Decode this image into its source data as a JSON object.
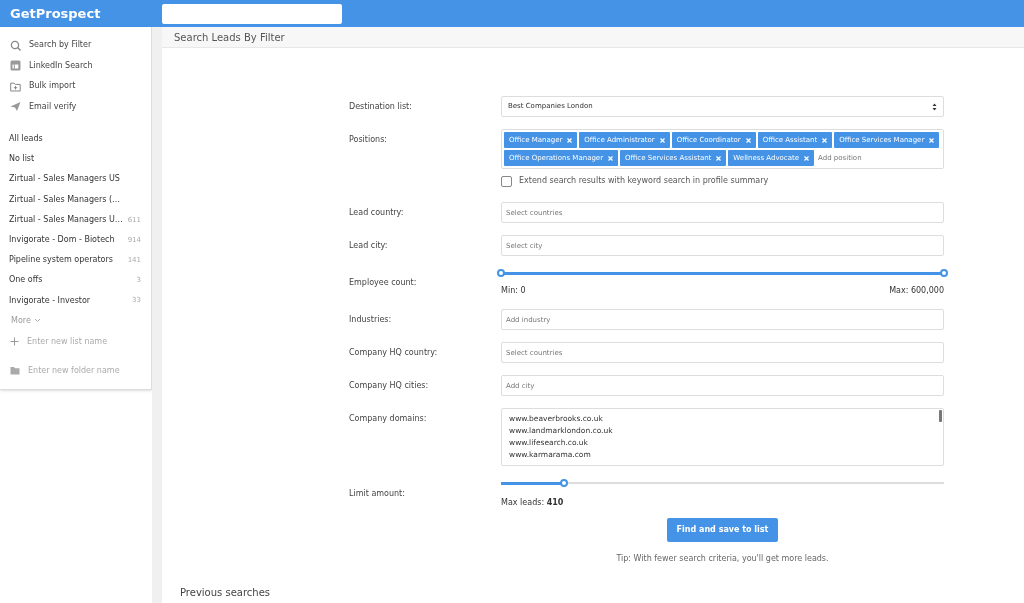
{
  "app": {
    "logo": "GetProspect"
  },
  "sidebar": {
    "nav": [
      {
        "label": "Search by Filter"
      },
      {
        "label": "LinkedIn Search"
      },
      {
        "label": "Bulk import"
      },
      {
        "label": "Email verify"
      }
    ],
    "lists": [
      {
        "label": "All leads"
      },
      {
        "label": "No list"
      },
      {
        "label": "Zirtual - Sales Managers US"
      },
      {
        "label": "Zirtual - Sales Managers (…"
      },
      {
        "label": "Zirtual - Sales Managers U…",
        "count": "611"
      },
      {
        "label": "Invigorate - Dom - Biotech",
        "count": "914"
      },
      {
        "label": "Pipeline system operators",
        "count": "141"
      },
      {
        "label": "One offs",
        "count": "3"
      },
      {
        "label": "Invigorate - Investor",
        "count": "33"
      }
    ],
    "more": "More",
    "new_list": {
      "placeholder": "Enter new list name"
    },
    "new_folder": {
      "placeholder": "Enter new folder name"
    }
  },
  "page": {
    "title": "Search Leads By Filter"
  },
  "form": {
    "destination": {
      "label": "Destination list:",
      "value": "Best Companies London"
    },
    "positions": {
      "label": "Positions:",
      "tags": [
        "Office Manager",
        "Office Administrator",
        "Office Coordinator",
        "Office Assistant",
        "Office Services Manager",
        "Office Operations Manager",
        "Office Services Assistant",
        "Wellness Advocate"
      ],
      "placeholder": "Add position"
    },
    "extend": {
      "label": "Extend search results with keyword search in profile summary",
      "checked": false
    },
    "inputs": [
      {
        "label": "Lead country:",
        "placeholder": "Select countries"
      },
      {
        "label": "Lead city:",
        "placeholder": "Select city"
      }
    ],
    "employee": {
      "label": "Employee count:",
      "low": {
        "level": 0
      },
      "high": {
        "level": 1
      },
      "min": "Min: 0",
      "max": "Max: 600,000"
    },
    "inputs2": [
      {
        "label": "Industries:",
        "placeholder": "Add industry"
      },
      {
        "label": "Company HQ country:",
        "placeholder": "Select countries"
      },
      {
        "label": "Company HQ cities:",
        "placeholder": "Add city"
      }
    ],
    "domains": {
      "label": "Company domains:",
      "lines": [
        "www.beaverbrooks.co.uk",
        "www.landmarklondon.co.uk",
        "www.lifesearch.co.uk",
        "www.karmarama.com"
      ]
    },
    "limit": {
      "label": "Limit amount:",
      "level": 0.142,
      "text": "Max leads: **410**"
    },
    "submit": "Find and save to list",
    "tip": "Tip: With fewer search criteria, you'll get more leads."
  },
  "previous": {
    "title": "Previous searches"
  }
}
